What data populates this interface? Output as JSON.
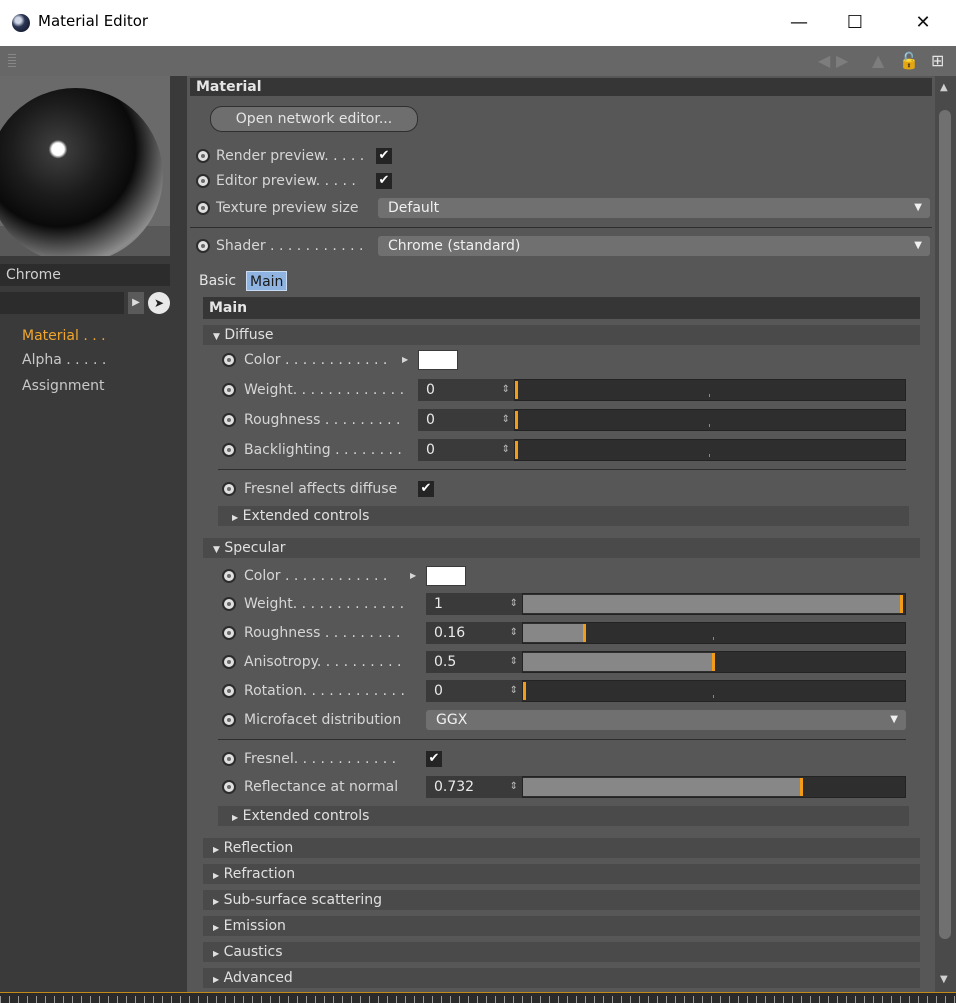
{
  "window": {
    "title": "Material Editor",
    "minimize": "—",
    "maximize": "☐",
    "close": "✕"
  },
  "material_name": "Chrome",
  "nav": [
    "Material . . .",
    "Alpha . . . . .",
    "Assignment"
  ],
  "header": {
    "title": "Material",
    "open_network_editor": "Open network editor...",
    "render_preview_label": "Render preview. . . . .",
    "editor_preview_label": "Editor preview. . . . .",
    "texture_preview_label": "Texture preview size",
    "texture_preview_value": "Default",
    "shader_label": "Shader . . . . . . . . . . .",
    "shader_value": "Chrome (standard)"
  },
  "tabs": [
    "Basic",
    "Main"
  ],
  "main_title": "Main",
  "diffuse": {
    "title": "Diffuse",
    "color_label": "Color . . . . . . . . . . . .",
    "weight_label": "Weight. . . . . . . . . . . . .",
    "weight_value": "0",
    "roughness_label": "Roughness . . . . . . . . .",
    "roughness_value": "0",
    "backlighting_label": "Backlighting . . . . . . . .",
    "backlighting_value": "0",
    "fresnel_affects_label": "Fresnel affects diffuse",
    "extended": "Extended controls"
  },
  "specular": {
    "title": "Specular",
    "color_label": "Color . . . . . . . . . . . .",
    "weight_label": "Weight. . . . . . . . . . . . .",
    "weight_value": "1",
    "roughness_label": "Roughness . . . . . . . . .",
    "roughness_value": "0.16",
    "anisotropy_label": "Anisotropy. . . . . . . . . .",
    "anisotropy_value": "0.5",
    "rotation_label": "Rotation. . . . . . . . . . . .",
    "rotation_value": "0",
    "microfacet_label": "Microfacet distribution",
    "microfacet_value": "GGX",
    "fresnel_label": "Fresnel. . . . . . . . . . . .",
    "reflectance_label": "Reflectance at normal",
    "reflectance_value": "0.732",
    "extended": "Extended controls"
  },
  "sliders": {
    "diffuse_weight": 0,
    "diffuse_roughness": 0,
    "diffuse_backlighting": 0,
    "specular_weight": 1,
    "specular_roughness": 0.16,
    "specular_anisotropy": 0.5,
    "specular_rotation": 0,
    "reflectance": 0.732
  },
  "collapsed_sections": [
    "Reflection",
    "Refraction",
    "Sub-surface scattering",
    "Emission",
    "Caustics",
    "Advanced"
  ],
  "icons": {
    "expanded": "▼",
    "collapsed": "▶",
    "check": "✔",
    "dropdown": "▼",
    "spin": "⇕"
  },
  "colors": {
    "accent": "#f29c17",
    "active_tab": "#8fb4e2",
    "panel": "#575757"
  }
}
